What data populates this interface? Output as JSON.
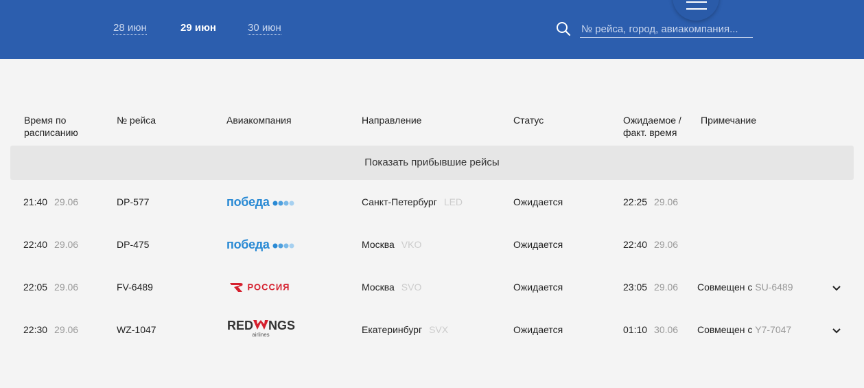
{
  "header": {
    "dates": [
      {
        "label": "28 июн",
        "active": false
      },
      {
        "label": "29 июн",
        "active": true
      },
      {
        "label": "30 июн",
        "active": false
      }
    ],
    "search_placeholder": "№ рейса, город, авиакомпания..."
  },
  "table": {
    "headers": {
      "scheduled_line1": "Время по",
      "scheduled_line2": "расписанию",
      "flight": "№ рейса",
      "airline": "Авиакомпания",
      "direction": "Направление",
      "status": "Статус",
      "expected_line1": "Ожидаемое /",
      "expected_line2": "факт. время",
      "note": "Примечание"
    },
    "show_arrived_label": "Показать прибывшие рейсы",
    "rows": [
      {
        "time": "21:40",
        "date": "29.06",
        "flight": "DP-577",
        "airline": "pobeda",
        "city": "Санкт-Петербург",
        "code": "LED",
        "status": "Ожидается",
        "exp_time": "22:25",
        "exp_date": "29.06",
        "note_prefix": "",
        "note_code": ""
      },
      {
        "time": "22:40",
        "date": "29.06",
        "flight": "DP-475",
        "airline": "pobeda",
        "city": "Москва",
        "code": "VKO",
        "status": "Ожидается",
        "exp_time": "22:40",
        "exp_date": "29.06",
        "note_prefix": "",
        "note_code": ""
      },
      {
        "time": "22:05",
        "date": "29.06",
        "flight": "FV-6489",
        "airline": "rossiya",
        "city": "Москва",
        "code": "SVO",
        "status": "Ожидается",
        "exp_time": "23:05",
        "exp_date": "29.06",
        "note_prefix": "Совмещен с ",
        "note_code": "SU-6489"
      },
      {
        "time": "22:30",
        "date": "29.06",
        "flight": "WZ-1047",
        "airline": "redwings",
        "city": "Екатеринбург",
        "code": "SVX",
        "status": "Ожидается",
        "exp_time": "01:10",
        "exp_date": "30.06",
        "note_prefix": "Совмещен с ",
        "note_code": "Y7-7047"
      }
    ]
  },
  "logos": {
    "pobeda": "победа",
    "rossiya": "РОССИЯ",
    "redwings_main_a": "RED",
    "redwings_main_b": "NGS",
    "redwings_sub": "airlines"
  },
  "colors": {
    "header_bg": "#2c5eae",
    "pobeda_blue": "#2a8ad4",
    "rossiya_red": "#d5202e"
  }
}
